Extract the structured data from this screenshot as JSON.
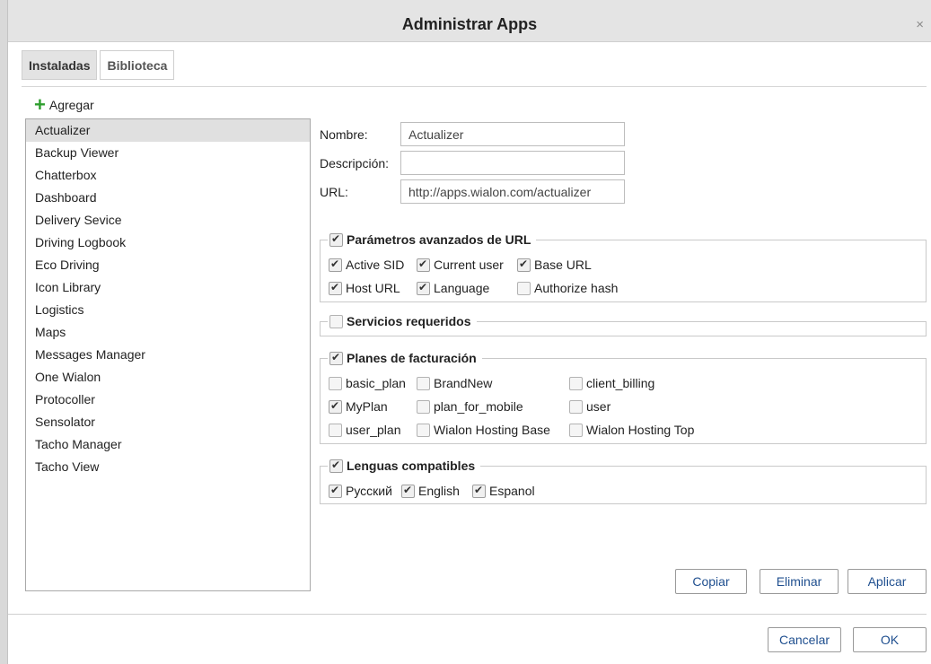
{
  "dialog": {
    "title": "Administrar Apps",
    "close_glyph": "×"
  },
  "tabs": [
    {
      "label": "Instaladas",
      "active": true
    },
    {
      "label": "Biblioteca",
      "active": false
    }
  ],
  "add_button": {
    "icon": "plus-icon",
    "label": "Agregar",
    "color": "#2e9e2e"
  },
  "apps": [
    "Actualizer",
    "Backup Viewer",
    "Chatterbox",
    "Dashboard",
    "Delivery Sevice",
    "Driving Logbook",
    "Eco Driving",
    "Icon Library",
    "Logistics",
    "Maps",
    "Messages Manager",
    "One Wialon",
    "Protocoller",
    "Sensolator",
    "Tacho Manager",
    "Tacho View"
  ],
  "selected_app": "Actualizer",
  "form": {
    "name_label": "Nombre:",
    "name_value": "Actualizer",
    "description_label": "Descripción:",
    "description_value": "",
    "url_label": "URL:",
    "url_value": "http://apps.wialon.com/actualizer"
  },
  "advanced_url": {
    "label": "Parámetros avanzados de URL",
    "checked": true,
    "options": [
      {
        "label": "Active SID",
        "checked": true
      },
      {
        "label": "Current user",
        "checked": true
      },
      {
        "label": "Base URL",
        "checked": true
      },
      {
        "label": "Host URL",
        "checked": true
      },
      {
        "label": "Language",
        "checked": true
      },
      {
        "label": "Authorize hash",
        "checked": false
      }
    ]
  },
  "required_services": {
    "label": "Servicios requeridos",
    "checked": false
  },
  "billing_plans": {
    "label": "Planes de facturación",
    "checked": true,
    "options": [
      {
        "label": "basic_plan",
        "checked": false
      },
      {
        "label": "BrandNew",
        "checked": false
      },
      {
        "label": "client_billing",
        "checked": false
      },
      {
        "label": "MyPlan",
        "checked": true
      },
      {
        "label": "plan_for_mobile",
        "checked": false
      },
      {
        "label": "user",
        "checked": false
      },
      {
        "label": "user_plan",
        "checked": false
      },
      {
        "label": "Wialon Hosting Base",
        "checked": false
      },
      {
        "label": "Wialon Hosting Top",
        "checked": false
      }
    ]
  },
  "languages": {
    "label": "Lenguas compatibles",
    "checked": true,
    "options": [
      {
        "label": "Русский",
        "checked": true
      },
      {
        "label": "English",
        "checked": true
      },
      {
        "label": "Espanol",
        "checked": true
      }
    ]
  },
  "actions": {
    "copy": "Copiar",
    "delete": "Eliminar",
    "apply": "Aplicar"
  },
  "footer": {
    "cancel": "Cancelar",
    "ok": "OK"
  },
  "colors": {
    "button_text": "#1f4f8f",
    "title_bar": "#e4e4e4"
  }
}
